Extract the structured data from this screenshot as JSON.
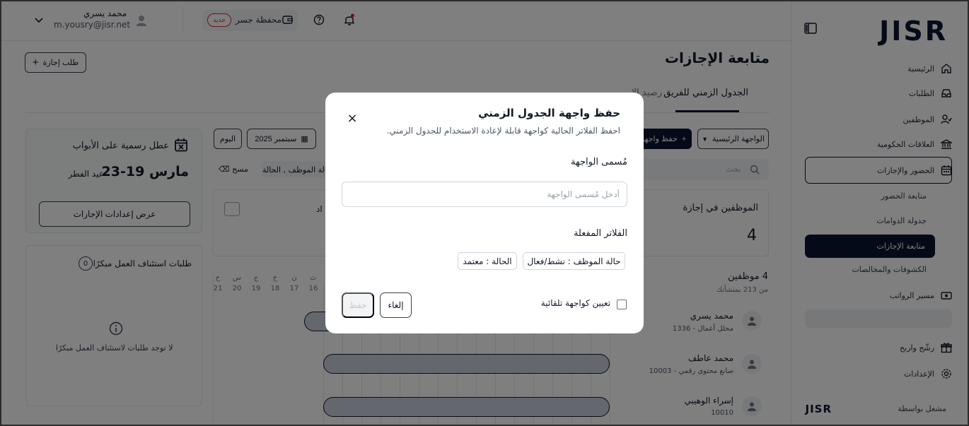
{
  "app": {
    "logo": "JISR",
    "powered_by": "مشغل بواسطة",
    "powered_logo": "JISR"
  },
  "sidebar": {
    "items": [
      {
        "label": "الرئيسية",
        "icon": "home-icon"
      },
      {
        "label": "الطلبات",
        "icon": "inbox-icon"
      },
      {
        "label": "الموظفين",
        "icon": "users-icon"
      },
      {
        "label": "العلاقات الحكومية",
        "icon": "bank-icon"
      },
      {
        "label": "الحضور والإجازات",
        "icon": "calendar-icon"
      }
    ],
    "sub_items": [
      "متابعة الحضور",
      "جدولة الدوامات",
      "متابعة الإجازات",
      "الكشوفات والمخالصات"
    ],
    "bottom_items": [
      {
        "label": "مسير الرواتب",
        "icon": "money-icon"
      },
      {
        "label": "رشّح واربح",
        "icon": "gift-icon"
      },
      {
        "label": "الإعدادات",
        "icon": "gear-icon"
      }
    ]
  },
  "topbar": {
    "user_name": "محمد يسري",
    "user_email": "m.yousry@jisr.net",
    "wallet_label": "محفظة جسر",
    "new_badge": "جديد"
  },
  "page": {
    "title": "متابعة الإجازات",
    "request_leave_button": "طلب إجازة",
    "tabs": [
      "الجدول الزمني للفريق",
      "رصيد الإ"
    ],
    "view_select": "الواجهة الرئيسية",
    "save_view_button": "حفظ واجهة",
    "month_picker": "سبتمبر 2025",
    "today_button": "اليوم",
    "search_placeholder": "بحث",
    "filter_chip": "حالة الموظف , الحالة",
    "clear_button": "مسح",
    "on_leave_label": "الموظفين في إجازة",
    "on_leave_count": "4",
    "employees_count_title": "4 موظفين",
    "employees_count_sub": "من 213 بمنشأتك",
    "employees": [
      {
        "name": "محمد يسري",
        "sub": "محلل أعمال - 1336"
      },
      {
        "name": "محمد عاطف",
        "sub": "صانع محتوى رقمي - 10003"
      },
      {
        "name": "إسراء الوهيبي",
        "sub": "10010"
      }
    ],
    "days": [
      {
        "abbr": "ث",
        "num": "16"
      },
      {
        "abbr": "ن",
        "num": "17"
      },
      {
        "abbr": "خ",
        "num": "18"
      },
      {
        "abbr": "ج",
        "num": "19"
      },
      {
        "abbr": "س",
        "num": "20"
      },
      {
        "abbr": "ح",
        "num": "21"
      }
    ],
    "holiday_card": {
      "title": "عطل رسمية على الأبواب",
      "date": "مارس 19-23",
      "name": "عيد الفطر",
      "button": "عرض إعدادات الإجازات"
    },
    "early_return_card": {
      "title": "طلبات استئناف العمل مبكرًا",
      "count": "0",
      "empty": "لا توجد طلبات لاستئناف العمل مبكرًا"
    },
    "card_fragment": "اد"
  },
  "modal": {
    "title": "حفظ واجهة الجدول الزمني",
    "subtitle": "احفظ الفلاتر الحالية كواجهة قابلة لإعادة الاستخدام للجدول الزمني.",
    "name_label": "مُسمى الواجهة",
    "name_placeholder": "أدخل مُسمى الواجهة",
    "name_value": "",
    "filters_label": "الفلاتر المفعلة",
    "filters": [
      "حالة الموظف : نشط/فعال",
      "الحالة : معتمد"
    ],
    "auto_checkbox_label": "تعيين كواجهة تلقائية",
    "cancel_button": "إلغاء",
    "save_button": "حفظ",
    "close_symbol": "×"
  }
}
